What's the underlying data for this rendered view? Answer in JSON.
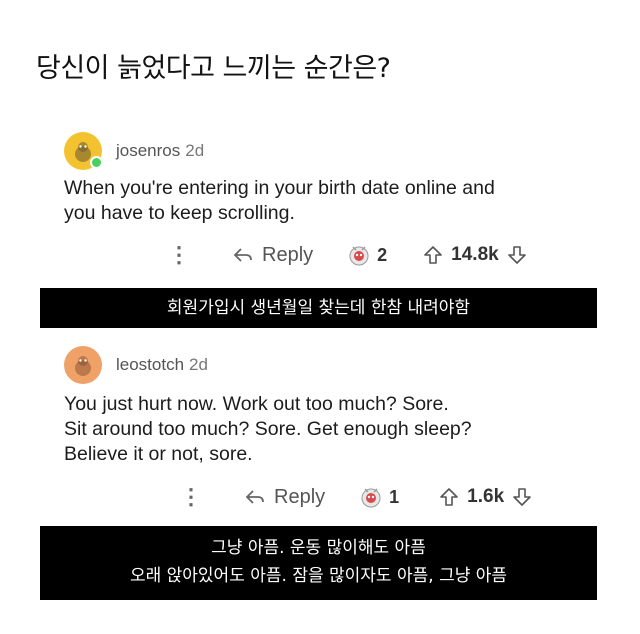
{
  "title": "당신이 늙었다고 느끼는 순간은?",
  "comments": [
    {
      "username": "josenros",
      "age": "2d",
      "lines": [
        "When you're entering in your birth date online and",
        "you have to keep scrolling."
      ],
      "reply_label": "Reply",
      "award_count": "2",
      "score": "14.8k",
      "avatar_color": "#f2c230",
      "caption_lines": [
        "회원가입시 생년월일 찾는데 한참 내려야함"
      ]
    },
    {
      "username": "leostotch",
      "age": "2d",
      "lines": [
        "You just hurt now.  Work out too much?  Sore.",
        "Sit around too much?  Sore.  Get enough sleep?",
        "Believe it or not, sore."
      ],
      "reply_label": "Reply",
      "award_count": "1",
      "score": "1.6k",
      "avatar_color": "#f0a167",
      "caption_lines": [
        "그냥 아픔. 운동 많이해도 아픔",
        "오래 앉아있어도 아픔.  잠을 많이자도 아픔, 그냥 아픔"
      ]
    }
  ],
  "icons": {
    "more": "more-options-icon",
    "reply": "reply-arrow-icon",
    "award": "award-icon",
    "upvote": "upvote-arrow-icon",
    "downvote": "downvote-arrow-icon"
  }
}
